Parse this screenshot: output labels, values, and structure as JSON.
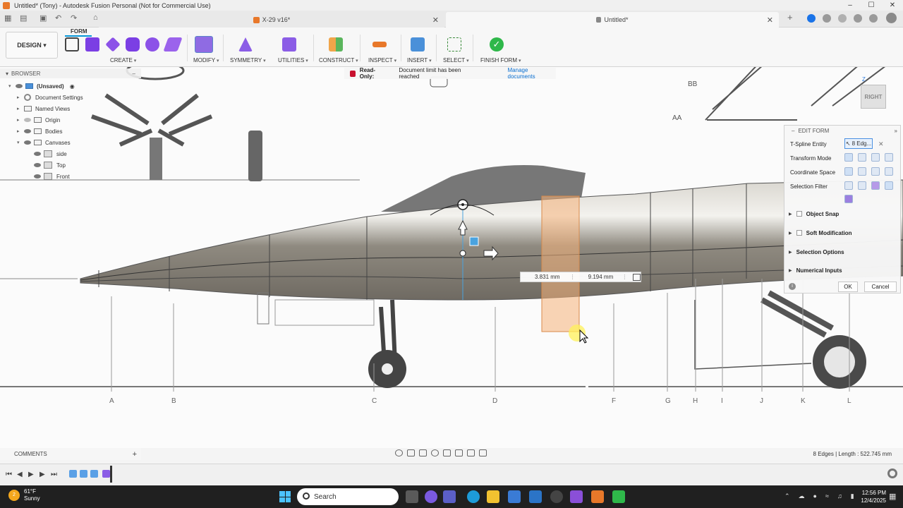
{
  "window": {
    "title": "Untitled* (Tony) - Autodesk Fusion Personal (Not for Commercial Use)",
    "controls": [
      "–",
      "☐",
      "✕"
    ]
  },
  "tabs": [
    {
      "label": "X-29 v16*",
      "active": false
    },
    {
      "label": "Untitled*",
      "active": true
    }
  ],
  "toolbar": {
    "workspace": "DESIGN",
    "active_tab": "FORM",
    "groups": [
      "CREATE",
      "MODIFY",
      "SYMMETRY",
      "UTILITIES",
      "CONSTRUCT",
      "INSPECT",
      "INSERT",
      "SELECT",
      "FINISH FORM"
    ]
  },
  "browser": {
    "title": "BROWSER",
    "items": [
      {
        "label": "(Unsaved)"
      },
      {
        "label": "Document Settings"
      },
      {
        "label": "Named Views"
      },
      {
        "label": "Origin"
      },
      {
        "label": "Bodies"
      },
      {
        "label": "Canvases"
      },
      {
        "label": "side"
      },
      {
        "label": "Top"
      },
      {
        "label": "Front"
      }
    ]
  },
  "notice": {
    "label": "Read-Only:",
    "message": "Document limit has been reached",
    "link": "Manage documents"
  },
  "viewcube": {
    "face": "RIGHT",
    "axis": "Z"
  },
  "edit_form": {
    "title": "EDIT FORM",
    "tspline_label": "T-Spline Entity",
    "tspline_value": "8 Edg...",
    "transform_mode": "Transform Mode",
    "coordinate_space": "Coordinate Space",
    "selection_filter": "Selection Filter",
    "object_snap": "Object Snap",
    "soft_modification": "Soft Modification",
    "selection_options": "Selection Options",
    "numerical_inputs": "Numerical Inputs",
    "ok": "OK",
    "cancel": "Cancel"
  },
  "dimension_inputs": {
    "first": "3.831 mm",
    "second": "9.194 mm"
  },
  "station_labels": [
    "A",
    "B",
    "C",
    "D",
    "F",
    "G",
    "H",
    "I",
    "J",
    "K",
    "L"
  ],
  "canvas_labels": {
    "bb": "BB",
    "aa": "AA"
  },
  "comments": {
    "label": "COMMENTS"
  },
  "status": {
    "selection": "8 Edges | Length : 522.745 mm"
  },
  "taskbar": {
    "temperature": "61°F",
    "condition": "Sunny",
    "search_placeholder": "Search",
    "time": "12:56 PM",
    "date": "12/4/2025",
    "weather_badge": "2"
  }
}
